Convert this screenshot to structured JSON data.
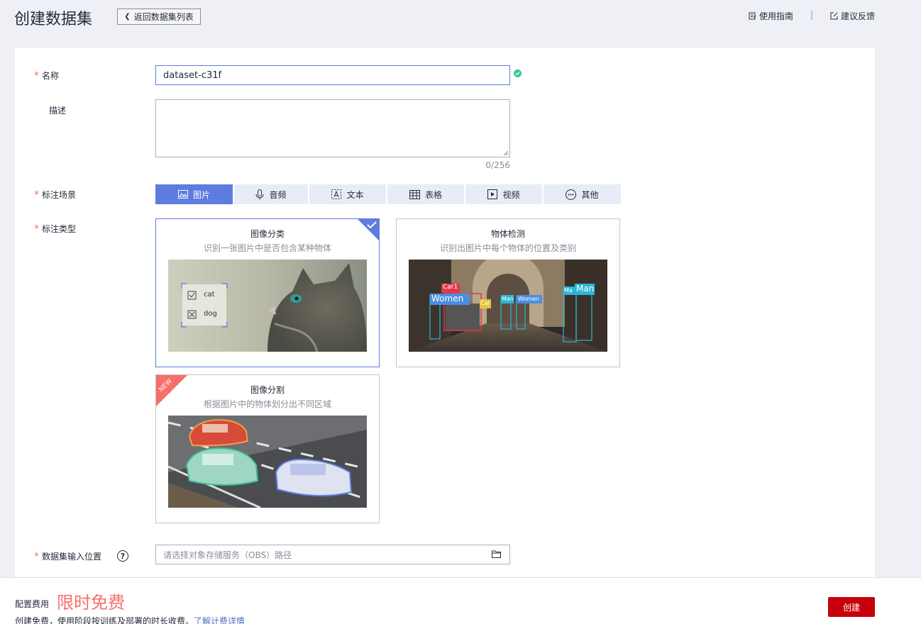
{
  "header": {
    "title": "创建数据集",
    "back_label": "返回数据集列表",
    "guide_label": "使用指南",
    "separator": "|",
    "feedback_label": "建议反馈"
  },
  "form": {
    "required_mark": "*",
    "name": {
      "label": "名称",
      "value": "dataset-c31f"
    },
    "description": {
      "label": "描述",
      "value": "",
      "counter": "0/256"
    },
    "scene": {
      "label": "标注场景",
      "tabs": [
        {
          "label": "图片",
          "icon": "image-icon",
          "active": true
        },
        {
          "label": "音频",
          "icon": "microphone-icon",
          "active": false
        },
        {
          "label": "文本",
          "icon": "text-icon",
          "active": false
        },
        {
          "label": "表格",
          "icon": "table-icon",
          "active": false
        },
        {
          "label": "视频",
          "icon": "video-icon",
          "active": false
        },
        {
          "label": "其他",
          "icon": "more-icon",
          "active": false
        }
      ]
    },
    "annotation_type": {
      "label": "标注类型",
      "cards": [
        {
          "title": "图像分类",
          "desc": "识别一张图片中是否包含某种物体",
          "selected": true,
          "labels": [
            "cat",
            "dog"
          ]
        },
        {
          "title": "物体检测",
          "desc": "识别出图片中每个物体的位置及类别",
          "selected": false,
          "labels": [
            "Car1",
            "Women",
            "Car",
            "Man",
            "Women",
            "Ma",
            "Man"
          ]
        },
        {
          "title": "图像分割",
          "desc": "根据图片中的物体划分出不同区域",
          "selected": false,
          "badge": "NEW"
        }
      ]
    },
    "input_location": {
      "label": "数据集输入位置",
      "help": "?",
      "placeholder": "请选择对象存储服务（OBS）路径"
    }
  },
  "footer": {
    "fee_label": "配置费用",
    "fee_value": "限时免费",
    "note": "创建免费，使用阶段按训练及部署的时长收费。",
    "link": "了解计费详情",
    "create_label": "创建"
  },
  "colors": {
    "primary": "#5e7ce0",
    "danger": "#c7000b",
    "required": "#f66f6a",
    "success": "#3ac295",
    "page_bg": "#eef0f5"
  }
}
